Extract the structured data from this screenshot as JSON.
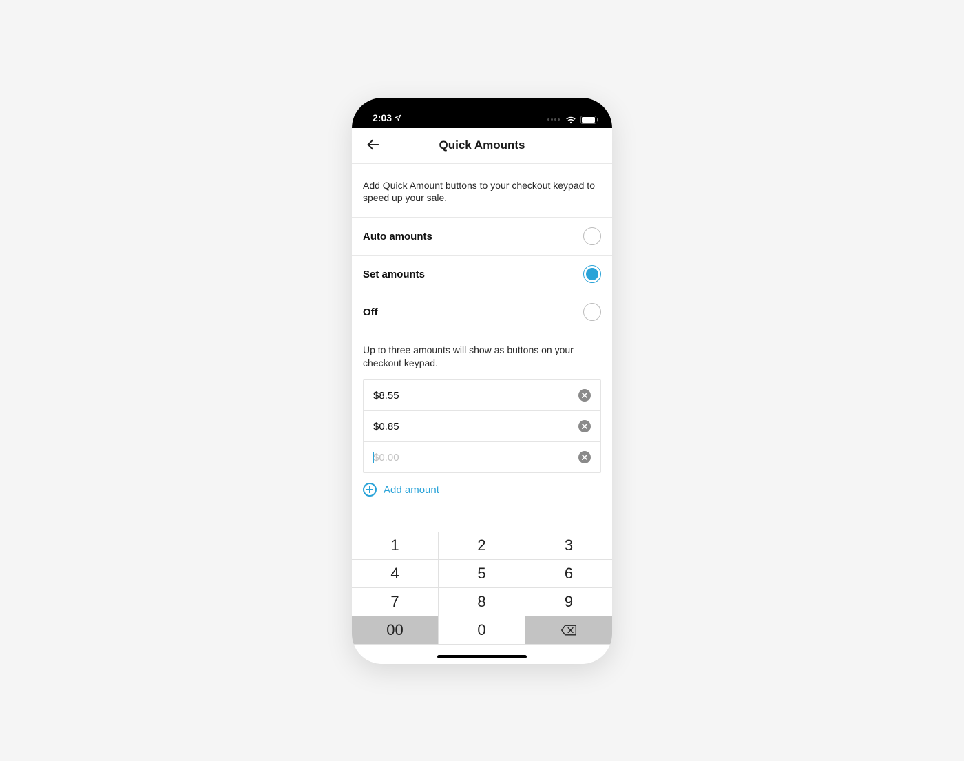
{
  "statusBar": {
    "time": "2:03"
  },
  "nav": {
    "title": "Quick Amounts"
  },
  "description": "Add Quick Amount buttons to your checkout keypad to speed up your sale.",
  "options": {
    "auto": {
      "label": "Auto amounts",
      "selected": false
    },
    "set": {
      "label": "Set amounts",
      "selected": true
    },
    "off": {
      "label": "Off",
      "selected": false
    }
  },
  "subDescription": "Up to three amounts will show as buttons on your checkout keypad.",
  "amounts": {
    "row0": "$8.55",
    "row1": "$0.85",
    "row2_placeholder": "$0.00"
  },
  "addAmount": "Add amount",
  "keypad": {
    "k1": "1",
    "k2": "2",
    "k3": "3",
    "k4": "4",
    "k5": "5",
    "k6": "6",
    "k7": "7",
    "k8": "8",
    "k9": "9",
    "k00": "00",
    "k0": "0"
  }
}
